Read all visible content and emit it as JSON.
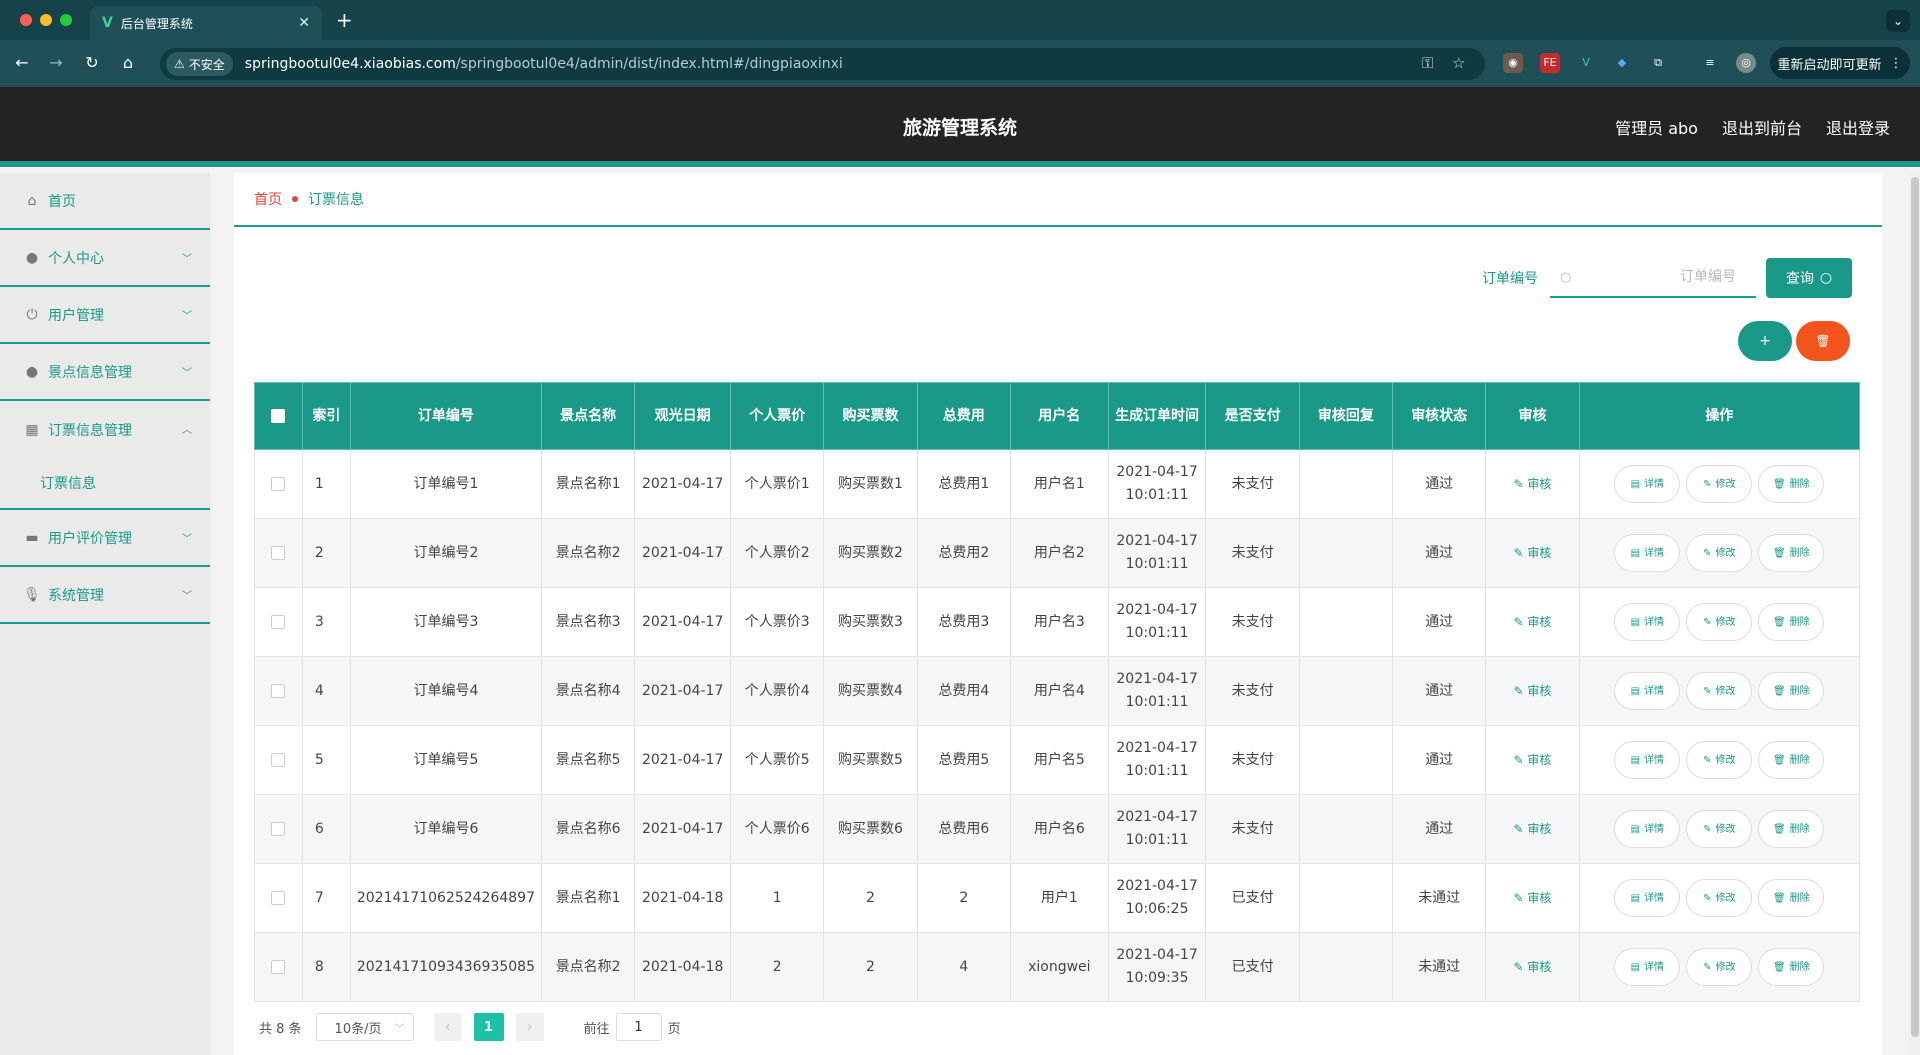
{
  "browser": {
    "tab_title": "后台管理系统",
    "insecure_label": "不安全",
    "url_host": "springbootul0e4.xiaobias.com",
    "url_path": "/springbootul0e4/admin/dist/index.html#/dingpiaoxinxi",
    "relaunch_label": "重新启动即可更新"
  },
  "header": {
    "title": "旅游管理系统",
    "user_label": "管理员 abo",
    "front_link": "退出到前台",
    "logout_link": "退出登录"
  },
  "sidebar": {
    "items": [
      {
        "label": "首页",
        "icon": "home-icon"
      },
      {
        "label": "个人中心",
        "icon": "user-icon"
      },
      {
        "label": "用户管理",
        "icon": "power-icon"
      },
      {
        "label": "景点信息管理",
        "icon": "user-icon"
      },
      {
        "label": "订票信息管理",
        "icon": "grid-icon"
      },
      {
        "label": "用户评价管理",
        "icon": "printer-icon"
      },
      {
        "label": "系统管理",
        "icon": "mic-icon"
      }
    ],
    "sub_item": "订票信息"
  },
  "breadcrumb": {
    "home": "首页",
    "current": "订票信息"
  },
  "search": {
    "label": "订单编号",
    "placeholder": "订单编号",
    "button": "查询"
  },
  "table": {
    "headers": [
      "索引",
      "订单编号",
      "景点名称",
      "观光日期",
      "个人票价",
      "购买票数",
      "总费用",
      "用户名",
      "生成订单时间",
      "是否支付",
      "审核回复",
      "审核状态",
      "审核",
      "操作"
    ],
    "rows": [
      {
        "idx": "1",
        "order_no": "订单编号1",
        "spot": "景点名称1",
        "date": "2021-04-17",
        "price": "个人票价1",
        "count": "购买票数1",
        "total": "总费用1",
        "user": "用户名1",
        "created": "2021-04-17 10:01:11",
        "paid": "未支付",
        "reply": "",
        "status": "通过"
      },
      {
        "idx": "2",
        "order_no": "订单编号2",
        "spot": "景点名称2",
        "date": "2021-04-17",
        "price": "个人票价2",
        "count": "购买票数2",
        "total": "总费用2",
        "user": "用户名2",
        "created": "2021-04-17 10:01:11",
        "paid": "未支付",
        "reply": "",
        "status": "通过"
      },
      {
        "idx": "3",
        "order_no": "订单编号3",
        "spot": "景点名称3",
        "date": "2021-04-17",
        "price": "个人票价3",
        "count": "购买票数3",
        "total": "总费用3",
        "user": "用户名3",
        "created": "2021-04-17 10:01:11",
        "paid": "未支付",
        "reply": "",
        "status": "通过"
      },
      {
        "idx": "4",
        "order_no": "订单编号4",
        "spot": "景点名称4",
        "date": "2021-04-17",
        "price": "个人票价4",
        "count": "购买票数4",
        "total": "总费用4",
        "user": "用户名4",
        "created": "2021-04-17 10:01:11",
        "paid": "未支付",
        "reply": "",
        "status": "通过"
      },
      {
        "idx": "5",
        "order_no": "订单编号5",
        "spot": "景点名称5",
        "date": "2021-04-17",
        "price": "个人票价5",
        "count": "购买票数5",
        "total": "总费用5",
        "user": "用户名5",
        "created": "2021-04-17 10:01:11",
        "paid": "未支付",
        "reply": "",
        "status": "通过"
      },
      {
        "idx": "6",
        "order_no": "订单编号6",
        "spot": "景点名称6",
        "date": "2021-04-17",
        "price": "个人票价6",
        "count": "购买票数6",
        "total": "总费用6",
        "user": "用户名6",
        "created": "2021-04-17 10:01:11",
        "paid": "未支付",
        "reply": "",
        "status": "通过"
      },
      {
        "idx": "7",
        "order_no": "20214171062524264897",
        "spot": "景点名称1",
        "date": "2021-04-18",
        "price": "1",
        "count": "2",
        "total": "2",
        "user": "用户1",
        "created": "2021-04-17 10:06:25",
        "paid": "已支付",
        "reply": "",
        "status": "未通过"
      },
      {
        "idx": "8",
        "order_no": "20214171093436935085",
        "spot": "景点名称2",
        "date": "2021-04-18",
        "price": "2",
        "count": "2",
        "total": "4",
        "user": "xiongwei",
        "created": "2021-04-17 10:09:35",
        "paid": "已支付",
        "reply": "",
        "status": "未通过"
      }
    ],
    "audit_label": "审核",
    "detail_label": "详情",
    "edit_label": "修改",
    "delete_label": "删除"
  },
  "pager": {
    "total": "共 8 条",
    "page_size": "10条/页",
    "current_page": "1",
    "goto_prefix": "前往",
    "goto_value": "1",
    "goto_suffix": "页"
  },
  "colors": {
    "accent": "#1a9988",
    "danger": "#f2541b",
    "header_bg": "#232323",
    "chrome_bg": "#1f4f57"
  }
}
